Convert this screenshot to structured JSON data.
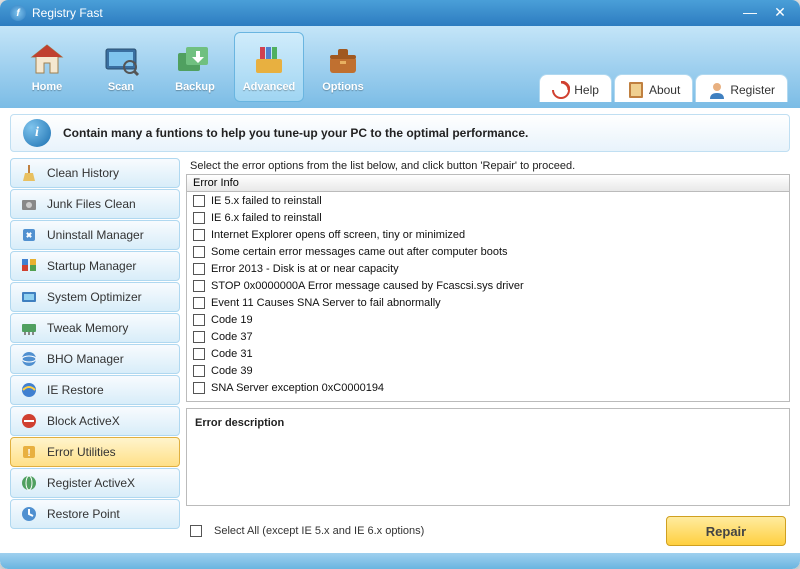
{
  "titlebar": {
    "title": "Registry Fast"
  },
  "toolbar": {
    "items": [
      {
        "label": "Home",
        "icon": "home"
      },
      {
        "label": "Scan",
        "icon": "scan"
      },
      {
        "label": "Backup",
        "icon": "backup"
      },
      {
        "label": "Advanced",
        "icon": "advanced",
        "active": true
      },
      {
        "label": "Options",
        "icon": "options"
      }
    ],
    "right": [
      {
        "label": "Help",
        "icon": "help"
      },
      {
        "label": "About",
        "icon": "about"
      },
      {
        "label": "Register",
        "icon": "register"
      }
    ]
  },
  "info_banner": "Contain many a funtions to help you tune-up your PC to the optimal performance.",
  "sidebar": {
    "items": [
      {
        "label": "Clean History",
        "icon": "broom"
      },
      {
        "label": "Junk Files Clean",
        "icon": "disk"
      },
      {
        "label": "Uninstall Manager",
        "icon": "uninstall"
      },
      {
        "label": "Startup Manager",
        "icon": "startup"
      },
      {
        "label": "System Optimizer",
        "icon": "optimize"
      },
      {
        "label": "Tweak Memory",
        "icon": "memory"
      },
      {
        "label": "BHO Manager",
        "icon": "bho"
      },
      {
        "label": "IE Restore",
        "icon": "ie"
      },
      {
        "label": "Block ActiveX",
        "icon": "block"
      },
      {
        "label": "Error Utilities",
        "icon": "error",
        "active": true
      },
      {
        "label": "Register ActiveX",
        "icon": "register"
      },
      {
        "label": "Restore Point",
        "icon": "restore"
      }
    ]
  },
  "main": {
    "instruction": "Select the error options from the list below, and click button 'Repair' to proceed.",
    "list_header": "Error Info",
    "errors": [
      "IE 5.x failed to reinstall",
      "IE 6.x failed to reinstall",
      "Internet Explorer opens off screen, tiny or minimized",
      "Some certain error messages came out after computer boots",
      "Error 2013 - Disk is at or near capacity",
      "STOP 0x0000000A Error message caused by Fcascsi.sys driver",
      "Event 11 Causes SNA Server to fail abnormally",
      "Code 19",
      "Code 37",
      "Code 31",
      "Code 39",
      "SNA Server exception 0xC0000194"
    ],
    "desc_title": "Error description",
    "select_all_label": "Select All  (except IE 5.x and IE 6.x options)",
    "repair_label": "Repair"
  }
}
